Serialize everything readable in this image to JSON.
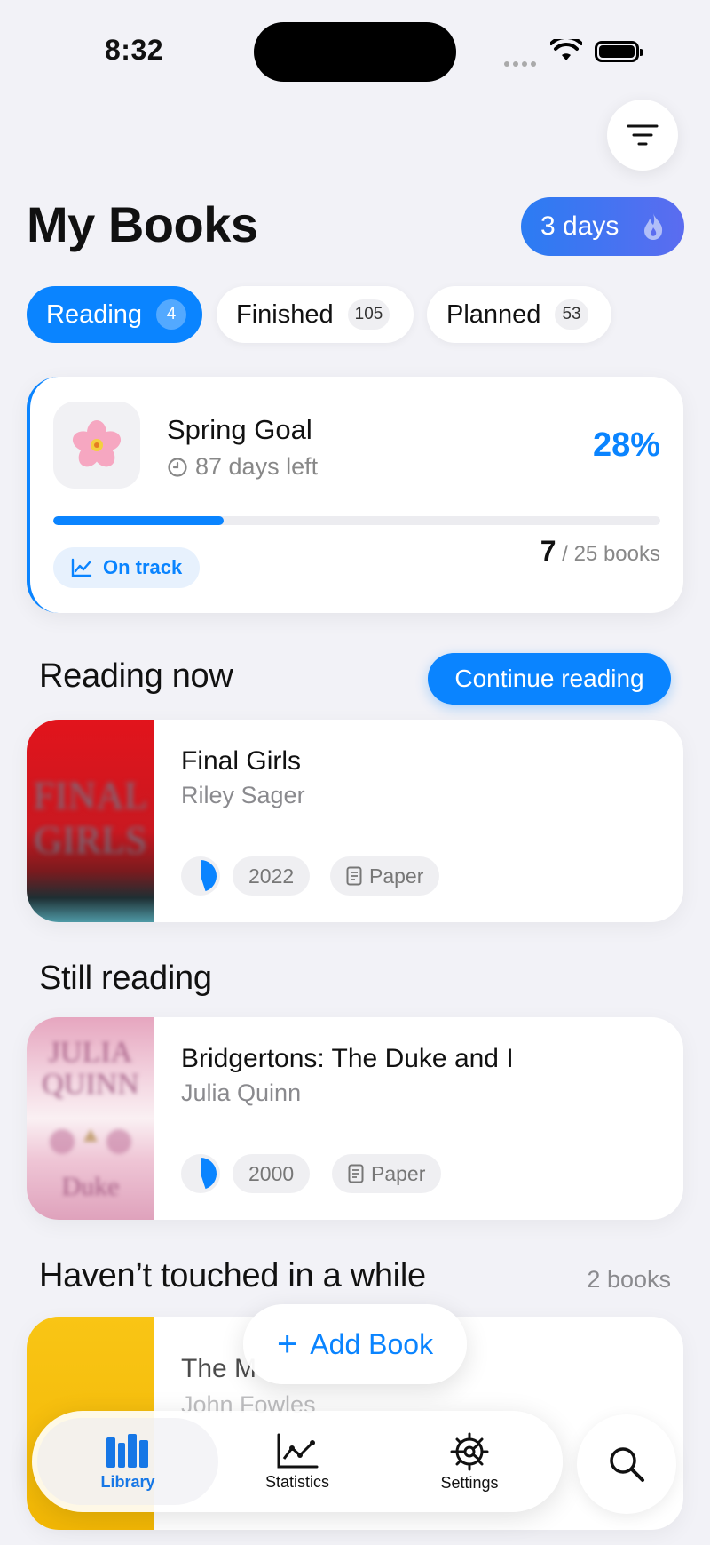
{
  "status_bar": {
    "time": "8:32"
  },
  "header": {
    "title": "My Books",
    "streak_label": "3 days"
  },
  "tabs": [
    {
      "label": "Reading",
      "count": "4",
      "active": true
    },
    {
      "label": "Finished",
      "count": "105",
      "active": false
    },
    {
      "label": "Planned",
      "count": "53",
      "active": false
    }
  ],
  "goal": {
    "emoji": "🌸",
    "title": "Spring Goal",
    "days_left": "87 days left",
    "percent_label": "28%",
    "progress_fraction": 0.28,
    "status": "On track",
    "books_read": "7",
    "books_total": "/ 25 books"
  },
  "sections": {
    "reading_now": {
      "title": "Reading now",
      "action": "Continue reading"
    },
    "still_reading": {
      "title": "Still reading"
    },
    "stale": {
      "title": "Haven’t touched in a while",
      "count": "2 books"
    }
  },
  "books": [
    {
      "title": "Final Girls",
      "author": "Riley Sager",
      "year": "2022",
      "format": "Paper",
      "progress": 0.45,
      "cover_colors": [
        "#d8171f",
        "#1b2a2f"
      ]
    },
    {
      "title": "Bridgertons: The Duke and I",
      "author": "Julia Quinn",
      "year": "2000",
      "format": "Paper",
      "progress": 0.45,
      "cover_colors": [
        "#e9b4c8",
        "#f6e5ec"
      ]
    },
    {
      "title": "The M",
      "author": "John Fowles",
      "cover_colors": [
        "#f7c21a",
        "#f2b705"
      ]
    }
  ],
  "add_book": {
    "label": "Add Book"
  },
  "tabbar": [
    {
      "label": "Library",
      "icon": "books-icon",
      "active": true
    },
    {
      "label": "Statistics",
      "icon": "chart-icon",
      "active": false
    },
    {
      "label": "Settings",
      "icon": "gear-icon",
      "active": false
    }
  ],
  "colors": {
    "accent": "#0a84ff",
    "background": "#f2f2f7"
  }
}
